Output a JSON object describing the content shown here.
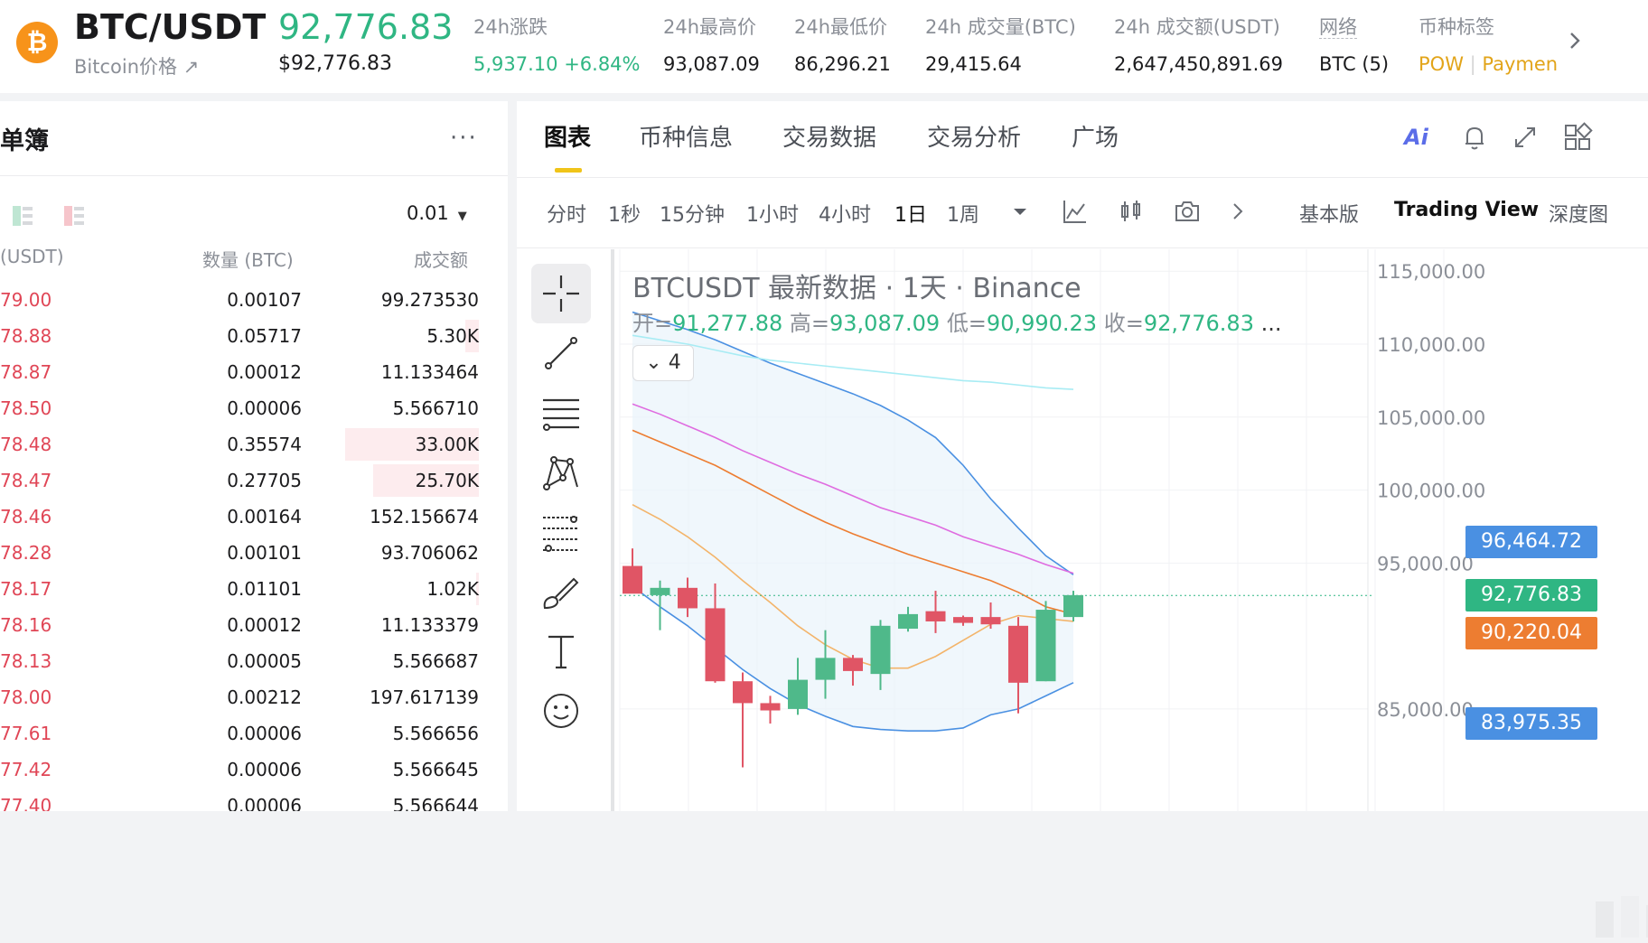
{
  "header": {
    "pair": "BTC/USDT",
    "coin_icon_glyph": "₿",
    "sub_link": "Bitcoin价格 ↗",
    "last_price": "92,776.83",
    "last_price_usd": "$92,776.83",
    "stats": [
      {
        "label": "24h涨跌",
        "value": "5,937.10 +6.84%"
      },
      {
        "label": "24h最高价",
        "value": "93,087.09"
      },
      {
        "label": "24h最低价",
        "value": "86,296.21"
      },
      {
        "label": "24h 成交量(BTC)",
        "value": "29,415.64"
      },
      {
        "label": "24h 成交额(USDT)",
        "value": "2,647,450,891.69"
      },
      {
        "label": "网络",
        "value": "BTC (5)"
      }
    ],
    "tags_label": "币种标签",
    "tags": [
      "POW",
      "Paymen"
    ]
  },
  "orderbook": {
    "title": "单簿",
    "more": "···",
    "precision": "0.01",
    "col_price": "(USDT)",
    "col_qty": "数量 (BTC)",
    "col_total": "成交额",
    "rows": [
      {
        "price": "79.00",
        "qty": "0.00107",
        "total": "99.273530",
        "depth": 0.0
      },
      {
        "price": "78.88",
        "qty": "0.05717",
        "total": "5.30K",
        "depth": 0.1
      },
      {
        "price": "78.87",
        "qty": "0.00012",
        "total": "11.133464",
        "depth": 0.0
      },
      {
        "price": "78.50",
        "qty": "0.00006",
        "total": "5.566710",
        "depth": 0.0
      },
      {
        "price": "78.48",
        "qty": "0.35574",
        "total": "33.00K",
        "depth": 1.0
      },
      {
        "price": "78.47",
        "qty": "0.27705",
        "total": "25.70K",
        "depth": 0.79
      },
      {
        "price": "78.46",
        "qty": "0.00164",
        "total": "152.156674",
        "depth": 0.0
      },
      {
        "price": "78.28",
        "qty": "0.00101",
        "total": "93.706062",
        "depth": 0.0
      },
      {
        "price": "78.17",
        "qty": "0.01101",
        "total": "1.02K",
        "depth": 0.02
      },
      {
        "price": "78.16",
        "qty": "0.00012",
        "total": "11.133379",
        "depth": 0.0
      },
      {
        "price": "78.13",
        "qty": "0.00005",
        "total": "5.566687",
        "depth": 0.0
      },
      {
        "price": "78.00",
        "qty": "0.00212",
        "total": "197.617139",
        "depth": 0.0
      },
      {
        "price": "77.61",
        "qty": "0.00006",
        "total": "5.566656",
        "depth": 0.0
      },
      {
        "price": "77.42",
        "qty": "0.00006",
        "total": "5.566645",
        "depth": 0.0
      },
      {
        "price": "77.40",
        "qty": "0.00006",
        "total": "5.566644",
        "depth": 0.0
      }
    ]
  },
  "tabs": [
    "图表",
    "币种信息",
    "交易数据",
    "交易分析",
    "广场"
  ],
  "active_tab": "图表",
  "tab_icons": {
    "ai": "Ai"
  },
  "intervals": [
    "分时",
    "1秒",
    "15分钟",
    "1小时",
    "4小时",
    "1日",
    "1周"
  ],
  "active_interval": "1日",
  "views": [
    "基本版",
    "Trading View",
    "深度图"
  ],
  "active_view": "Trading View",
  "chart": {
    "title": "BTCUSDT 最新数据 · 1天 · Binance",
    "ohlc_labels": {
      "open": "开=",
      "high": "高=",
      "low": "低=",
      "close": "收="
    },
    "ohlc_values": {
      "open": "91,277.88",
      "high": "93,087.09",
      "low": "90,990.23",
      "close": "92,776.83"
    },
    "ellipsis": "...",
    "indicator_count": "4",
    "price_tags": [
      {
        "label": "96,464.72",
        "value": 96464.72,
        "color": "#4a90e2"
      },
      {
        "label": "92,776.83",
        "value": 92776.83,
        "color": "#2fb683"
      },
      {
        "label": "90,220.04",
        "value": 90220.04,
        "color": "#ed7d31"
      },
      {
        "label": "83,975.35",
        "value": 83975.35,
        "color": "#4a90e2"
      }
    ]
  },
  "chart_data": {
    "type": "candlestick",
    "title": "BTCUSDT 最新数据 · 1天 · Binance",
    "y_ticks": [
      "115,000.00",
      "110,000.00",
      "105,000.00",
      "100,000.00",
      "95,000.00",
      "85,000.00"
    ],
    "y_tick_values": [
      115000,
      110000,
      105000,
      100000,
      95000,
      85000
    ],
    "ylim": [
      78000,
      116500
    ],
    "candles": [
      {
        "open": 94800,
        "high": 96000,
        "low": 93300,
        "close": 92900
      },
      {
        "open": 92800,
        "high": 93800,
        "low": 90400,
        "close": 93300
      },
      {
        "open": 93300,
        "high": 94000,
        "low": 91300,
        "close": 91900
      },
      {
        "open": 91900,
        "high": 93600,
        "low": 86800,
        "close": 86900
      },
      {
        "open": 86900,
        "high": 87500,
        "low": 81000,
        "close": 85400
      },
      {
        "open": 85400,
        "high": 85900,
        "low": 84000,
        "close": 84900
      },
      {
        "open": 85000,
        "high": 88500,
        "low": 84600,
        "close": 87000
      },
      {
        "open": 87000,
        "high": 90400,
        "low": 85700,
        "close": 88500
      },
      {
        "open": 88500,
        "high": 88700,
        "low": 86600,
        "close": 87600
      },
      {
        "open": 87400,
        "high": 91100,
        "low": 86300,
        "close": 90700
      },
      {
        "open": 90500,
        "high": 92000,
        "low": 90300,
        "close": 91500
      },
      {
        "open": 91700,
        "high": 93100,
        "low": 90200,
        "close": 91000
      },
      {
        "open": 91300,
        "high": 91400,
        "low": 90700,
        "close": 90900
      },
      {
        "open": 91300,
        "high": 92300,
        "low": 90500,
        "close": 90800
      },
      {
        "open": 90700,
        "high": 91300,
        "low": 84700,
        "close": 86800
      },
      {
        "open": 86900,
        "high": 92400,
        "low": 86900,
        "close": 91800
      },
      {
        "open": 91300,
        "high": 93100,
        "low": 91000,
        "close": 92800
      }
    ],
    "series": [
      {
        "color": "#4a90e2",
        "values": [
          112200,
          111600,
          111000,
          110300,
          109500,
          108700,
          108000,
          107300,
          106600,
          105800,
          104800,
          103600,
          101700,
          99400,
          97400,
          95500,
          94200
        ]
      },
      {
        "color": "#4a90e2",
        "values": [
          93400,
          92000,
          90700,
          89200,
          87700,
          86400,
          85300,
          84500,
          83800,
          83600,
          83500,
          83500,
          83700,
          84600,
          85000,
          85900,
          86800
        ]
      },
      {
        "color": "#a8ecf4",
        "values": [
          110600,
          110300,
          110000,
          109600,
          109200,
          108900,
          108700,
          108500,
          108300,
          108100,
          107900,
          107700,
          107500,
          107400,
          107200,
          107000,
          106900
        ]
      },
      {
        "color": "#df6ce0",
        "values": [
          105900,
          105200,
          104400,
          103600,
          102700,
          101900,
          101100,
          100400,
          99600,
          98800,
          98200,
          97600,
          96800,
          96200,
          95600,
          94900,
          94300
        ]
      },
      {
        "color": "#ed7d31",
        "values": [
          104100,
          103300,
          102500,
          101700,
          100700,
          99700,
          98700,
          97800,
          97000,
          96300,
          95600,
          95000,
          94400,
          93800,
          93000,
          92000,
          91500
        ]
      },
      {
        "color": "#f3b46a",
        "values": [
          99000,
          98000,
          96800,
          95400,
          93800,
          92300,
          90700,
          89400,
          88400,
          87800,
          87800,
          88600,
          89700,
          90800,
          91400,
          91200,
          91000
        ]
      }
    ],
    "last_price": 92776.83
  }
}
